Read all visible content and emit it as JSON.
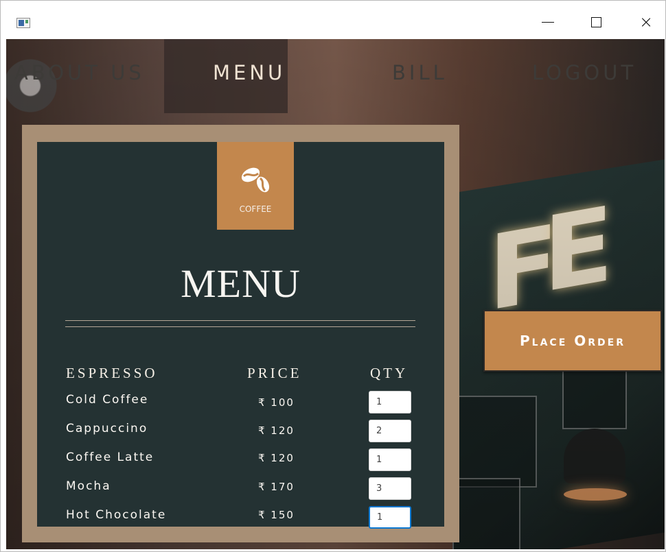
{
  "window": {
    "controls": {
      "minimize": "—",
      "maximize": "□",
      "close": "×"
    }
  },
  "nav": {
    "items": [
      {
        "label": "ABOUT US"
      },
      {
        "label": "MENU"
      },
      {
        "label": "BILL"
      },
      {
        "label": "LOGOUT"
      }
    ],
    "active": "MENU"
  },
  "menu": {
    "badge_label": "COFFEE",
    "title": "MENU",
    "columns": {
      "item": "ESPRESSO",
      "price": "PRICE",
      "qty": "QTY"
    },
    "items": [
      {
        "name": "Cold Coffee",
        "price": "₹ 100",
        "qty": "1"
      },
      {
        "name": "Cappuccino",
        "price": "₹ 120",
        "qty": "2"
      },
      {
        "name": "Coffee Latte",
        "price": "₹ 120",
        "qty": "1"
      },
      {
        "name": "Mocha",
        "price": "₹ 170",
        "qty": "3"
      },
      {
        "name": "Hot Chocolate",
        "price": "₹ 150",
        "qty": "1"
      }
    ]
  },
  "actions": {
    "place_order": "Place Order"
  },
  "colors": {
    "accent": "#c3874d",
    "board": "#243233",
    "frame": "#a88f75"
  },
  "icons": {
    "app": "app-window-icon",
    "coffee": "coffee-beans-icon"
  }
}
